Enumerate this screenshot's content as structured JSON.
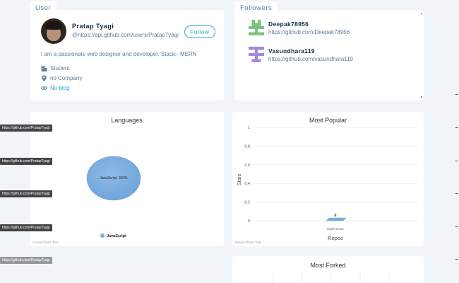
{
  "user_section": {
    "tab": "User",
    "name": "Pratap Tyagi",
    "handle": "@https://api.github.com/users/PratapTyagi",
    "follow_label": "Follow",
    "bio": "I am a passionate web designer and developer. Stack:- MERN",
    "company": "Student",
    "location": "no Company",
    "blog": "No blog",
    "icons": [
      "building-icon",
      "location-pin-icon",
      "link-icon"
    ]
  },
  "followers_section": {
    "tab": "Followers",
    "items": [
      {
        "name": "Deepak78956",
        "url": "https://github.com/Deepak78956",
        "avatar_color": "#7bc27e"
      },
      {
        "name": "Vasundhara119",
        "url": "https://github.com/vasundhara119",
        "avatar_color": "#a08bd6"
      }
    ]
  },
  "tooltips": [
    "https://github.com/PratapTyagi",
    "https://github.com/PratapTyagi",
    "https://github.com/PratapTyagi",
    "https://github.com/PratapTyagi",
    "https://github.com/PratapTyagi"
  ],
  "languages_chart": {
    "title": "Languages",
    "trial_text": "FusionCharts Trial",
    "pie_label": "JavaScript: 100%",
    "legend_label": "JavaScript",
    "color": "#7aaee0"
  },
  "popular_chart": {
    "title": "Most Popular",
    "trial_text": "FusionCharts Trial",
    "ylabel": "Stars",
    "xlabel": "Repos",
    "value_label": "0"
  },
  "forked_chart": {
    "title": "Most Forked"
  },
  "chart_data": [
    {
      "type": "pie",
      "title": "Languages",
      "categories": [
        "JavaScript"
      ],
      "values": [
        100
      ],
      "legend_position": "bottom"
    },
    {
      "type": "bar",
      "title": "Most Popular",
      "xlabel": "Repos",
      "ylabel": "Stars",
      "categories": [
        "tinder-clone"
      ],
      "values": [
        0
      ],
      "ylim": [
        0,
        1
      ],
      "yticks": [
        "0",
        "0.2",
        "0.4",
        "0.6",
        "0.8",
        "1"
      ],
      "grid": true
    }
  ]
}
